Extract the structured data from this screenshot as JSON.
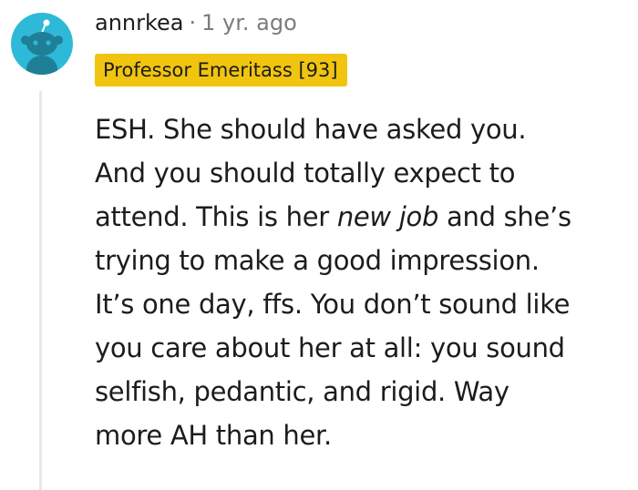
{
  "comment": {
    "username": "annrkea",
    "separator": "·",
    "timestamp": "1 yr. ago",
    "flair": "Professor Emeritass [93]",
    "avatar_icon": "reddit-snoo-avatar",
    "colors": {
      "avatar_bg": "#2fb9d8",
      "flair_bg": "#f1c40f",
      "meta_gray": "#7c7c7c",
      "text": "#1c1c1c",
      "thread_line": "#e6e8ea"
    },
    "body": {
      "line1": "ESH. She should have asked you.",
      "line2": "And you should totally expect to",
      "line3_before": "attend. This is her ",
      "line3_emphasis": "new job",
      "line3_after": " and she’s",
      "line4": "trying to make a good impression.",
      "line5": "It’s one day, ffs. You don’t sound like",
      "line6": "you care about her at all: you sound",
      "line7": "selfish, pedantic, and rigid. Way",
      "line8": "more AH than her."
    }
  }
}
